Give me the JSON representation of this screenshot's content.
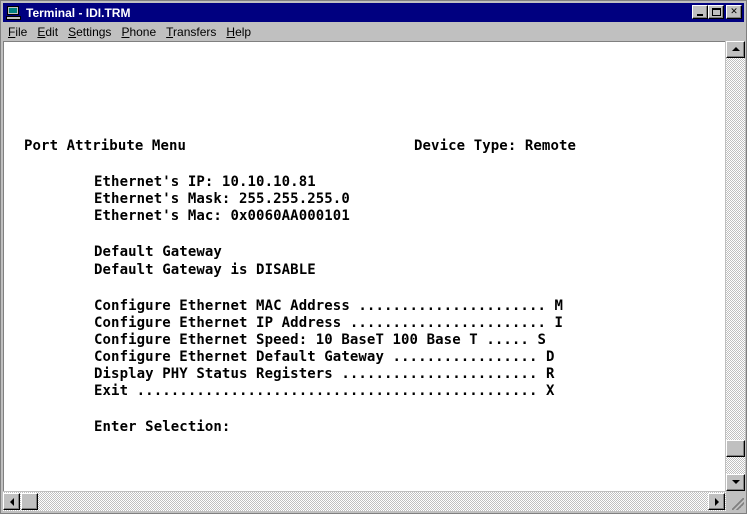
{
  "window": {
    "title": "Terminal - IDI.TRM",
    "icon": "terminal-computer-icon",
    "controls": [
      "minimize",
      "maximize",
      "close"
    ]
  },
  "menu": [
    {
      "underline": "F",
      "rest": "ile"
    },
    {
      "underline": "E",
      "rest": "dit"
    },
    {
      "underline": "S",
      "rest": "ettings"
    },
    {
      "underline": "P",
      "rest": "hone"
    },
    {
      "underline": "T",
      "rest": "ransfers"
    },
    {
      "underline": "H",
      "rest": "elp"
    }
  ],
  "terminal": {
    "menu_title": "Port Attribute Menu",
    "device_type": "Device Type: Remote",
    "ethernet_ip": "Ethernet's IP: 10.10.10.81",
    "ethernet_mask": "Ethernet's Mask: 255.255.255.0",
    "ethernet_mac": "Ethernet's Mac: 0x0060AA000101",
    "default_gateway": "Default Gateway",
    "gateway_status": "Default Gateway is DISABLE",
    "options": [
      "Configure Ethernet MAC Address ...................... M",
      "Configure Ethernet IP Address ....................... I",
      "Configure Ethernet Speed: 10 BaseT 100 Base T ..... S",
      "Configure Ethernet Default Gateway ................. D",
      "Display PHY Status Registers ....................... R",
      "Exit ............................................... X"
    ],
    "prompt": "Enter Selection:"
  }
}
